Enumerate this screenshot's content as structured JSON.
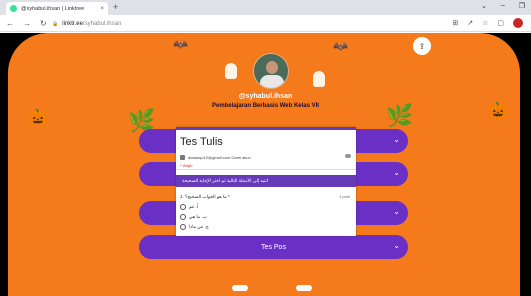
{
  "browser": {
    "tab_title": "@syhabul.ihsan | Linktree",
    "tab_close": "×",
    "new_tab": "+",
    "url_host": "linktr.ee",
    "url_path": "/syhabul.ihsan",
    "window_controls": [
      "⌄",
      "–",
      "❐"
    ]
  },
  "profile": {
    "handle": "@syhabul.ihsan",
    "subtitle": "Pembelajaran Berbasis Web Kelas VII"
  },
  "links": [
    {
      "label": ""
    },
    {
      "label": ""
    },
    {
      "label": ""
    },
    {
      "label": "Tes Pos"
    }
  ],
  "form": {
    "title": "Tes Tulis",
    "account": "alwasiqo12@gmail.com Ganti akun",
    "required": "* Wajib",
    "section": "انتبه إلى الأسئلة التالية ثم اختر الإجابة الصحيحة",
    "question": "1. ما هو الجواب الصحيح؟ *",
    "points": "1 poin",
    "options": [
      "أ. عم",
      "ب. ما هي",
      "ج. عن ماذا"
    ]
  },
  "colors": {
    "page_bg": "#000000",
    "theme": "#f47a1b",
    "button": "#6a2fc4",
    "form_accent": "#673ab7"
  }
}
